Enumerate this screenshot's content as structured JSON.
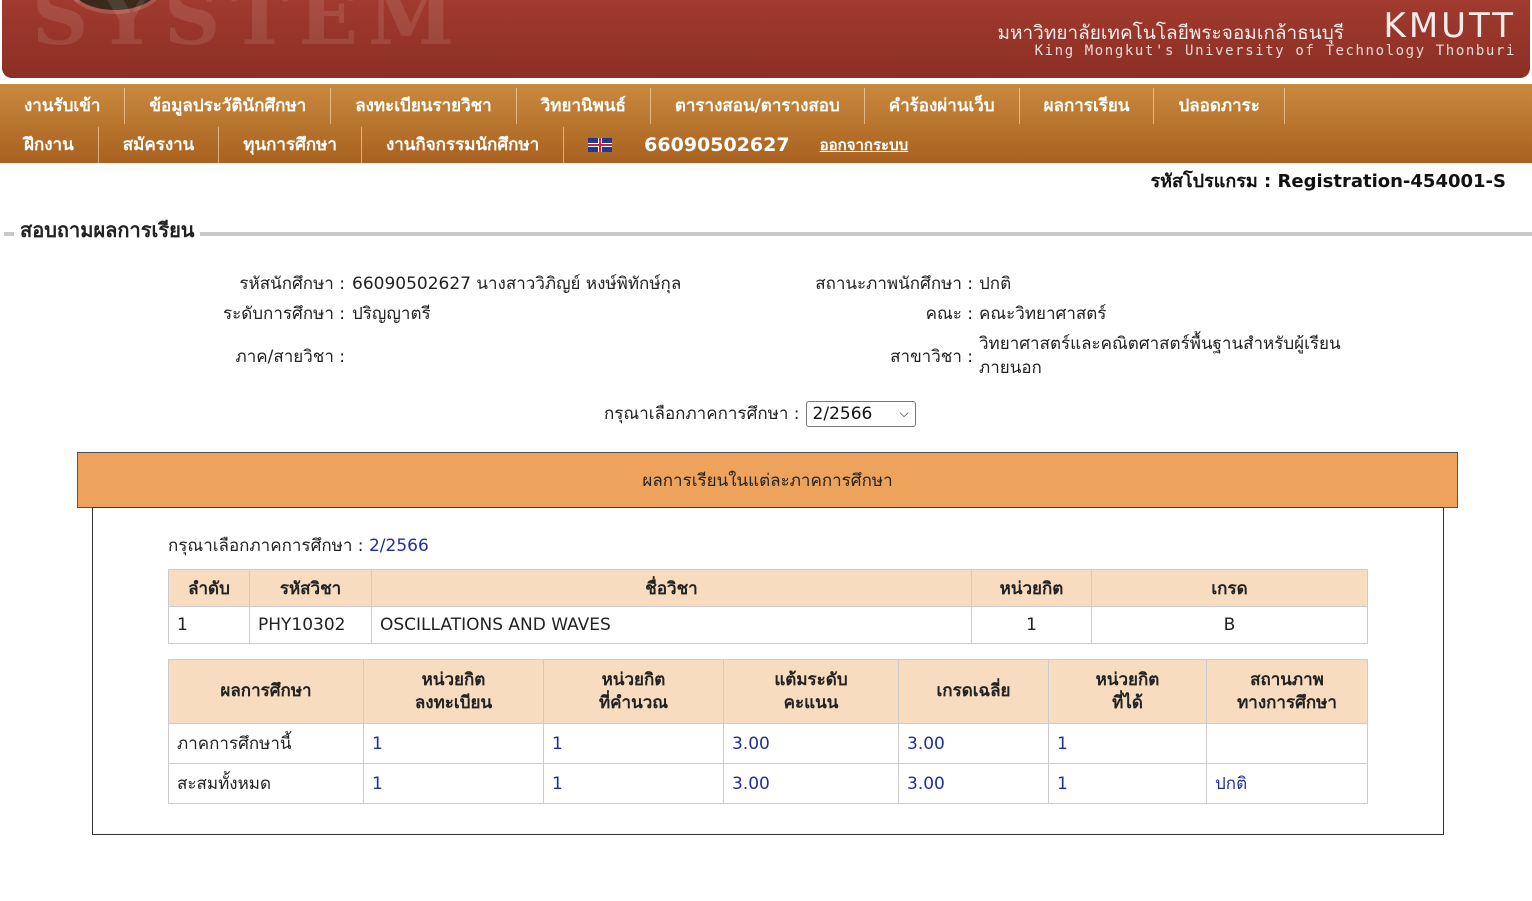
{
  "header": {
    "watermark": "SYSTEM",
    "university_th": "มหาวิทยาลัยเทคโนโลยีพระจอมเกล้าธนบุรี",
    "university_abbr": "KMUTT",
    "university_en": "King Mongkut's University of Technology Thonburi"
  },
  "nav": {
    "row1": [
      "งานรับเข้า",
      "ข้อมูลประวัตินักศึกษา",
      "ลงทะเบียนรายวิชา",
      "วิทยานิพนธ์",
      "ตารางสอน/ตารางสอบ",
      "คำร้องผ่านเว็บ",
      "ผลการเรียน",
      "ปลอดภาระ"
    ],
    "row2": [
      "ฝึกงาน",
      "สมัครงาน",
      "ทุนการศึกษา",
      "งานกิจกรรมนักศึกษา"
    ],
    "user_id": "66090502627",
    "logout": "ออกจากระบบ",
    "language_icon": "uk-flag-icon"
  },
  "program_code": "รหัสโปรแกรม : Registration-454001-S",
  "section_title": "สอบถามผลการเรียน",
  "student": {
    "id_label": "รหัสนักศึกษา :",
    "id_value": "66090502627 นางสาววิภิญย์ หงษ์พิทักษ์กุล",
    "status_label": "สถานะภาพนักศึกษา :",
    "status_value": "ปกติ",
    "level_label": "ระดับการศึกษา :",
    "level_value": "ปริญญาตรี",
    "faculty_label": "คณะ :",
    "faculty_value": "คณะวิทยาศาสตร์",
    "dept_label": "ภาค/สายวิชา :",
    "dept_value": "",
    "major_label": "สาขาวิชา :",
    "major_value_line1": "วิทยาศาสตร์และคณิตศาสตร์พื้นฐานสำหรับผู้เรียน",
    "major_value_line2": "ภายนอก"
  },
  "semester_select": {
    "label": "กรุณาเลือกภาคการศึกษา :",
    "selected": "2/2566"
  },
  "results": {
    "title": "ผลการเรียนในแต่ละภาคการศึกษา",
    "semester_label": "กรุณาเลือกภาคการศึกษา :",
    "semester_value": "2/2566",
    "course_headers": [
      "ลำดับ",
      "รหัสวิชา",
      "ชื่อวิชา",
      "หน่วยกิต",
      "เกรด"
    ],
    "courses": [
      {
        "no": "1",
        "code": "PHY10302",
        "name": "OSCILLATIONS AND WAVES",
        "credit": "1",
        "grade": "B"
      }
    ],
    "summary_headers": [
      {
        "l1": "ผลการศึกษา",
        "l2": ""
      },
      {
        "l1": "หน่วยกิต",
        "l2": "ลงทะเบียน"
      },
      {
        "l1": "หน่วยกิต",
        "l2": "ที่คำนวณ"
      },
      {
        "l1": "แต้มระดับ",
        "l2": "คะแนน"
      },
      {
        "l1": "เกรดเฉลี่ย",
        "l2": ""
      },
      {
        "l1": "หน่วยกิต",
        "l2": "ที่ได้"
      },
      {
        "l1": "สถานภาพ",
        "l2": "ทางการศึกษา"
      }
    ],
    "summary_rows": [
      {
        "label": "ภาคการศึกษานี้",
        "registered": "1",
        "calculated": "1",
        "points": "3.00",
        "gpa": "3.00",
        "earned": "1",
        "status": ""
      },
      {
        "label": "สะสมทั้งหมด",
        "registered": "1",
        "calculated": "1",
        "points": "3.00",
        "gpa": "3.00",
        "earned": "1",
        "status": "ปกติ"
      }
    ]
  }
}
